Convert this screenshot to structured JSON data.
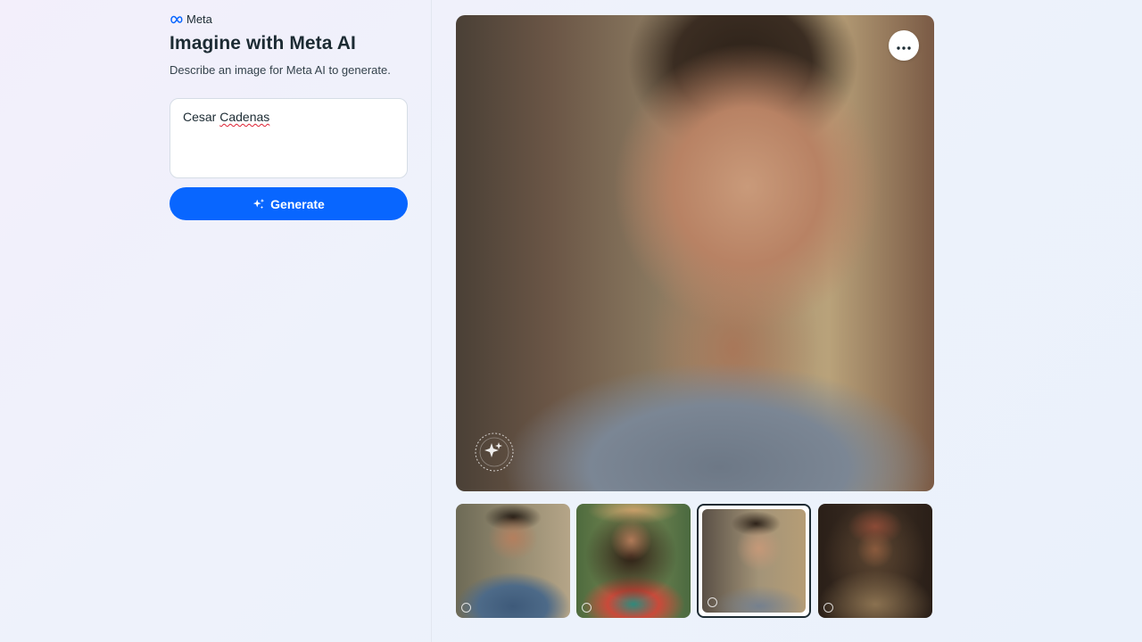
{
  "brand": {
    "name": "Meta",
    "logo_icon": "meta-infinity-icon",
    "logo_color": "#0866ff"
  },
  "header": {
    "title": "Imagine with Meta AI",
    "subtitle": "Describe an image for Meta AI to generate."
  },
  "prompt": {
    "value_first": "Cesar ",
    "value_misspelled": "Cadenas"
  },
  "generate_button": {
    "label": "Generate",
    "icon": "sparkle-icon",
    "color": "#0866ff"
  },
  "viewer": {
    "more_icon": "more-horizontal-icon",
    "watermark_icon": "imagined-with-ai-badge-icon"
  },
  "thumbnails": {
    "count": 4,
    "selected_index": 2
  }
}
